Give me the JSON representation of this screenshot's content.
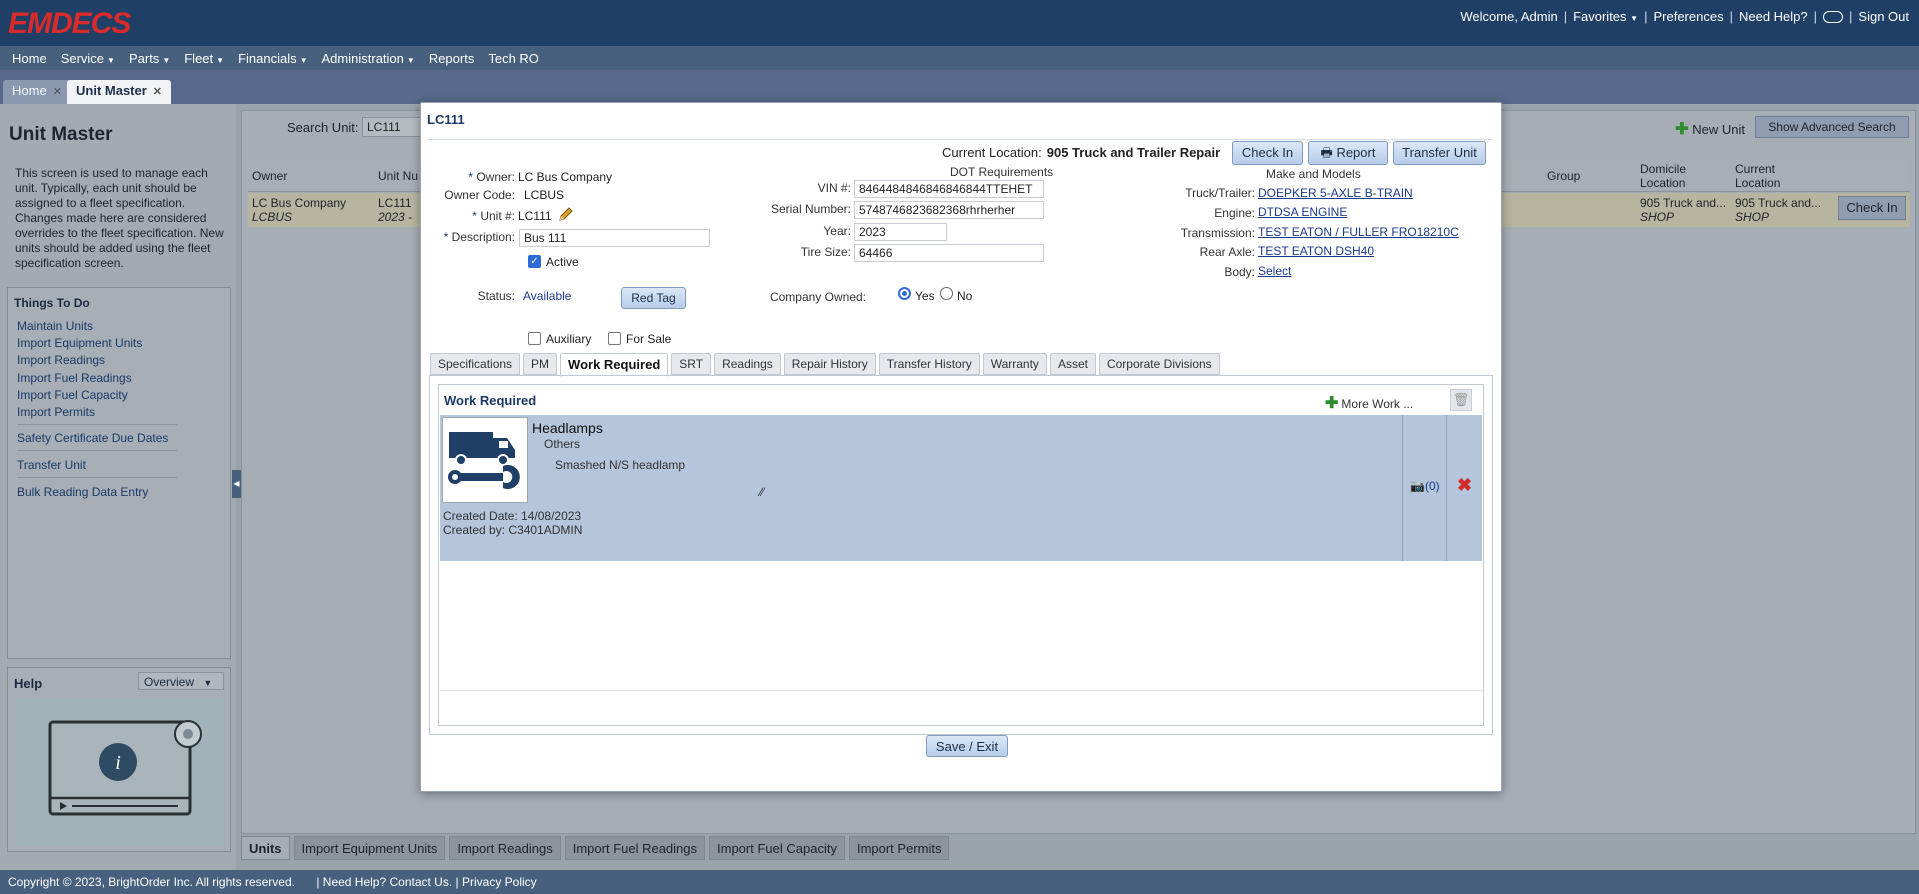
{
  "app": {
    "logo": "EMDECS",
    "header_links": [
      "Welcome, Admin",
      "Favorites",
      "Preferences",
      "Need Help?",
      "Sign Out"
    ],
    "menu": [
      "Home",
      "Service",
      "Parts",
      "Fleet",
      "Financials",
      "Administration",
      "Reports",
      "Tech RO"
    ],
    "page_tabs": [
      "Home",
      "Unit Master"
    ]
  },
  "left": {
    "title": "Unit Master",
    "description": "This screen is used to manage each unit. Typically, each unit should be assigned to a fleet specification. Changes made here are considered overrides to the fleet specification. New units should be added using the fleet specification screen.",
    "things_title": "Things To Do",
    "things": [
      "Maintain Units",
      "Import Equipment Units",
      "Import Readings",
      "Import Fuel Readings",
      "Import Fuel Capacity",
      "Import Permits",
      "Safety Certificate Due Dates",
      "Transfer Unit",
      "Bulk Reading Data Entry"
    ],
    "help_title": "Help",
    "help_select": "Overview"
  },
  "main": {
    "search_label": "Search Unit:",
    "search_value": "LC111",
    "new_unit": "New Unit",
    "advanced_search": "Show Advanced Search",
    "columns": [
      "Owner",
      "Unit Nu",
      "Group",
      "Domicile Location",
      "Current Location"
    ],
    "row": {
      "owner": "LC Bus Company",
      "owner_code": "LCBUS",
      "unit": "LC111",
      "unit_sub": "2023 -",
      "domicile": "905 Truck and...",
      "domicile_sub": "SHOP",
      "current": "905 Truck and...",
      "current_sub": "SHOP",
      "action": "Check In"
    },
    "bottom_tabs": [
      "Units",
      "Import Equipment Units",
      "Import Readings",
      "Import Fuel Readings",
      "Import Fuel Capacity",
      "Import Permits"
    ]
  },
  "footer": {
    "copyright": "Copyright © 2023, BrightOrder Inc. All rights reserved.",
    "help": "Need Help? Contact Us.",
    "privacy": "Privacy Policy"
  },
  "modal": {
    "title": "LC111",
    "current_location_label": "Current Location:",
    "current_location": "905 Truck and Trailer Repair",
    "buttons": {
      "check_in": "Check In",
      "report": "Report",
      "transfer": "Transfer Unit",
      "red_tag": "Red Tag",
      "save": "Save / Exit"
    },
    "owner_label": "Owner:",
    "owner": "LC Bus Company",
    "owner_code_label": "Owner Code:",
    "owner_code": "LCBUS",
    "unit_label": "Unit #:",
    "unit": "LC111",
    "description_label": "Description:",
    "description": "Bus 111",
    "active_label": "Active",
    "status_label": "Status:",
    "status": "Available",
    "auxiliary_label": "Auxiliary",
    "for_sale_label": "For Sale",
    "dot_title": "DOT Requirements",
    "vin_label": "VIN #:",
    "vin": "8464484846846846844TTEHET",
    "serial_label": "Serial Number:",
    "serial": "5748746823682368rhrherher",
    "year_label": "Year:",
    "year": "2023",
    "tire_label": "Tire Size:",
    "tire": "64466",
    "company_owned_label": "Company Owned:",
    "yes": "Yes",
    "no": "No",
    "mm_title": "Make and Models",
    "truck_label": "Truck/Trailer:",
    "truck": "DOEPKER 5-AXLE B-TRAIN",
    "engine_label": "Engine:",
    "engine": "DTDSA ENGINE",
    "transmission_label": "Transmission:",
    "transmission": "TEST EATON / FULLER FRO18210C",
    "rear_axle_label": "Rear Axle:",
    "rear_axle": "TEST EATON DSH40",
    "body_label": "Body:",
    "body": "Select",
    "tabs": [
      "Specifications",
      "PM",
      "Work Required",
      "SRT",
      "Readings",
      "Repair History",
      "Transfer History",
      "Warranty",
      "Asset",
      "Corporate Divisions"
    ],
    "work": {
      "header": "Work Required",
      "more": "More Work ...",
      "item_title": "Headlamps",
      "item_category": "Others",
      "item_desc": "Smashed N/S headlamp",
      "created_date": "Created Date:  14/08/2023",
      "created_by": "Created by:  C3401ADMIN",
      "photos": "(0)"
    }
  }
}
